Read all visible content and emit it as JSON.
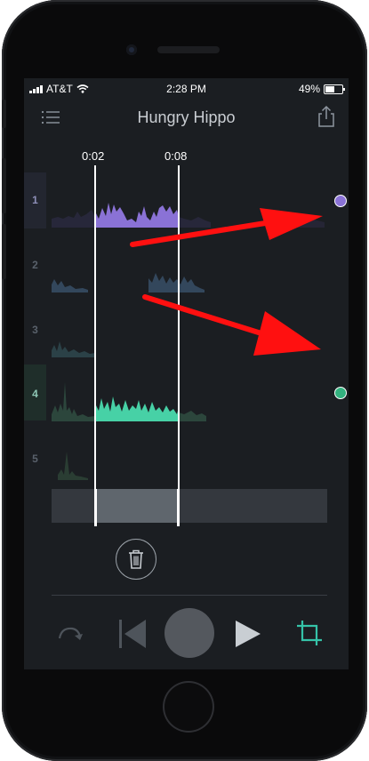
{
  "status_bar": {
    "carrier": "AT&T",
    "time": "2:28 PM",
    "battery": "49%",
    "battery_level": 0.49
  },
  "header": {
    "title": "Hungry Hippo"
  },
  "markers": {
    "start_time": "0:02",
    "end_time": "0:08"
  },
  "tracks": [
    {
      "number": "1",
      "color": "#8a72d6",
      "selected": true
    },
    {
      "number": "2",
      "color": "#33475c",
      "selected": false
    },
    {
      "number": "3",
      "color": "#2b4147",
      "selected": false
    },
    {
      "number": "4",
      "color": "#47d1a6",
      "selected": true
    },
    {
      "number": "5",
      "color": "#2a3d33",
      "selected": false
    }
  ],
  "colors": {
    "screen_bg": "#1b1e22",
    "accent_teal": "#35c3a8",
    "track1_dot": "#8a72d6",
    "track4_dot": "#33b17f",
    "arrow": "#ff1010"
  },
  "icons": {
    "menu": "menu-icon",
    "share": "share-icon",
    "trash": "trash-icon",
    "redo": "redo-icon",
    "skip_back": "skip-back-icon",
    "record": "record-icon",
    "play": "play-icon",
    "crop": "crop-icon"
  }
}
